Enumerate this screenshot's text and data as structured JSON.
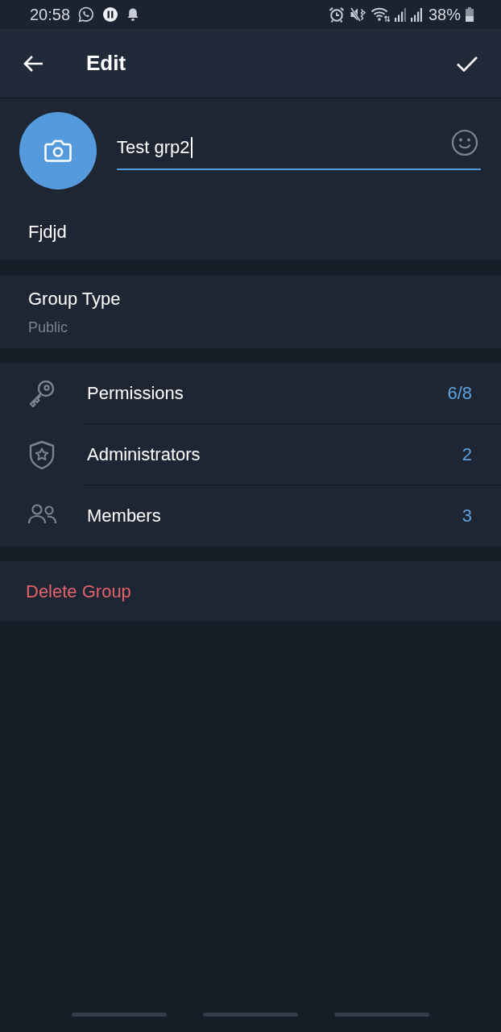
{
  "status_bar": {
    "time": "20:58",
    "battery": "38%"
  },
  "header": {
    "title": "Edit"
  },
  "profile": {
    "name": "Test grp2",
    "focused": true,
    "description": "Fjdjd"
  },
  "group_type": {
    "label": "Group Type",
    "value": "Public"
  },
  "settings": [
    {
      "kind": "key",
      "label": "Permissions",
      "value": "6/8"
    },
    {
      "kind": "shield",
      "label": "Administrators",
      "value": "2"
    },
    {
      "kind": "people",
      "label": "Members",
      "value": "3"
    }
  ],
  "delete": {
    "label": "Delete Group"
  }
}
